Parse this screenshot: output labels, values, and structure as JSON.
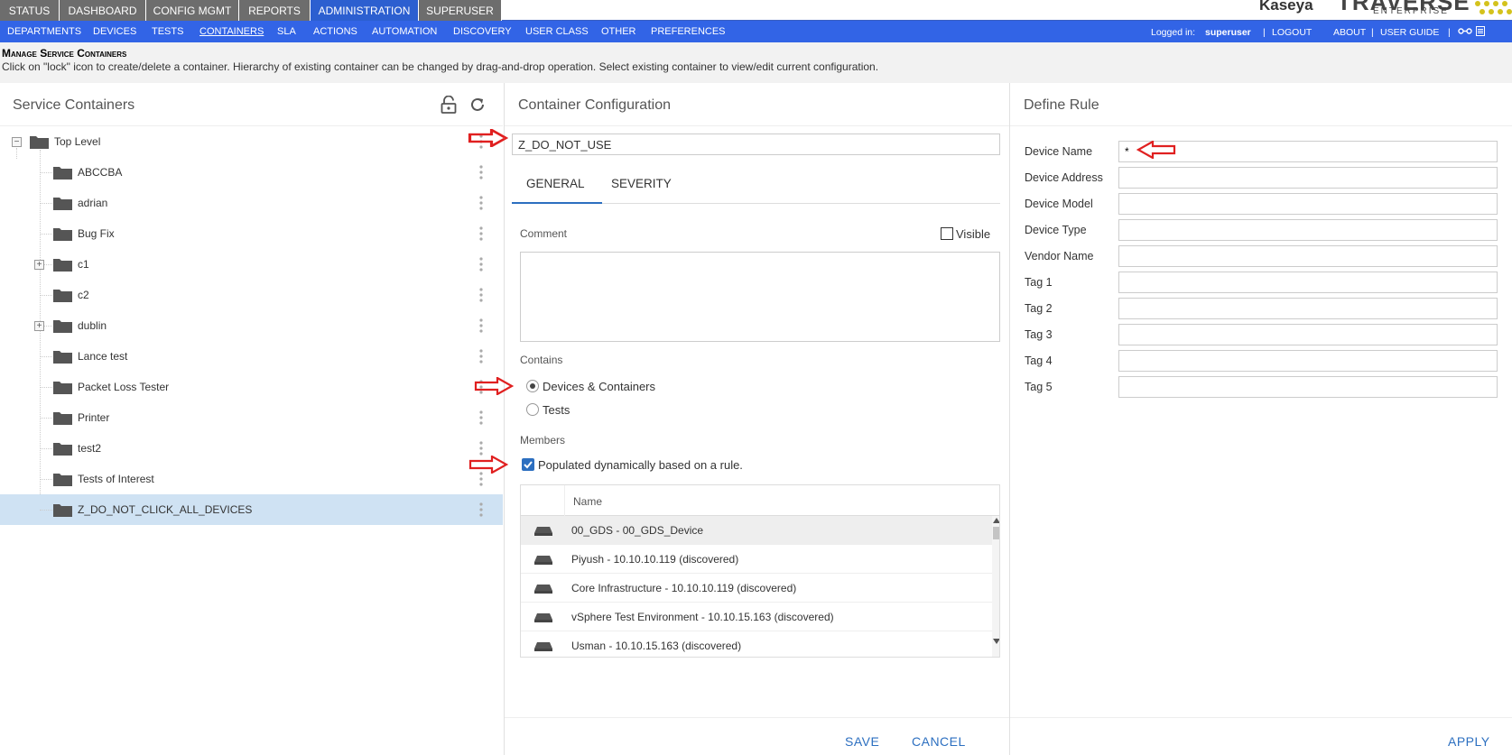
{
  "topnav": {
    "tabs": [
      {
        "label": "STATUS",
        "active": false
      },
      {
        "label": "DASHBOARD",
        "active": false
      },
      {
        "label": "CONFIG MGMT",
        "active": false
      },
      {
        "label": "REPORTS",
        "active": false
      },
      {
        "label": "ADMINISTRATION",
        "active": true
      },
      {
        "label": "SUPERUSER",
        "active": false
      }
    ],
    "brand": {
      "kaseya": "Kaseya",
      "product": "TRAVERSE",
      "edition": "ENTERPRISE"
    }
  },
  "subnav": {
    "items": [
      "DEPARTMENTS",
      "DEVICES",
      "TESTS",
      "CONTAINERS",
      "SLA",
      "ACTIONS",
      "AUTOMATION",
      "DISCOVERY",
      "USER CLASS",
      "OTHER",
      "PREFERENCES"
    ],
    "active": "CONTAINERS",
    "logged_in_label": "Logged in:",
    "username": "superuser",
    "logout": "LOGOUT",
    "about": "ABOUT",
    "user_guide": "USER GUIDE"
  },
  "page": {
    "title": "Manage Service Containers",
    "description": "Click on \"lock\" icon to create/delete a container. Hierarchy of existing container can be changed by drag-and-drop operation. Select existing container to view/edit current configuration."
  },
  "left": {
    "title": "Service Containers",
    "root": "Top Level",
    "items": [
      {
        "label": "ABCCBA",
        "expandable": false,
        "selected": false
      },
      {
        "label": "adrian",
        "expandable": false,
        "selected": false
      },
      {
        "label": "Bug Fix",
        "expandable": false,
        "selected": false
      },
      {
        "label": "c1",
        "expandable": true,
        "selected": false
      },
      {
        "label": "c2",
        "expandable": false,
        "selected": false
      },
      {
        "label": "dublin",
        "expandable": true,
        "selected": false
      },
      {
        "label": "Lance test",
        "expandable": false,
        "selected": false
      },
      {
        "label": "Packet Loss Tester",
        "expandable": false,
        "selected": false
      },
      {
        "label": "Printer",
        "expandable": false,
        "selected": false
      },
      {
        "label": "test2",
        "expandable": false,
        "selected": false
      },
      {
        "label": "Tests of Interest",
        "expandable": false,
        "selected": false
      },
      {
        "label": "Z_DO_NOT_CLICK_ALL_DEVICES",
        "expandable": false,
        "selected": true
      }
    ]
  },
  "mid": {
    "title": "Container Configuration",
    "container_name": "Z_DO_NOT_USE",
    "tabs": [
      "GENERAL",
      "SEVERITY"
    ],
    "active_tab": "GENERAL",
    "comment_label": "Comment",
    "visible_label": "Visible",
    "visible_checked": false,
    "comment_value": "",
    "contains_label": "Contains",
    "contains_options": [
      "Devices & Containers",
      "Tests"
    ],
    "contains_selected": "Devices & Containers",
    "members_label": "Members",
    "dynamic_label": "Populated dynamically based on a rule.",
    "dynamic_checked": true,
    "grid_header": "Name",
    "members": [
      "00_GDS - 00_GDS_Device",
      "Piyush - 10.10.10.119 (discovered)",
      "Core Infrastructure - 10.10.10.119 (discovered)",
      "vSphere Test Environment - 10.10.15.163 (discovered)",
      "Usman - 10.10.15.163 (discovered)"
    ],
    "save": "SAVE",
    "cancel": "CANCEL"
  },
  "right": {
    "title": "Define Rule",
    "fields": [
      {
        "label": "Device Name",
        "value": "*"
      },
      {
        "label": "Device Address",
        "value": ""
      },
      {
        "label": "Device Model",
        "value": ""
      },
      {
        "label": "Device Type",
        "value": ""
      },
      {
        "label": "Vendor Name",
        "value": ""
      },
      {
        "label": "Tag 1",
        "value": ""
      },
      {
        "label": "Tag 2",
        "value": ""
      },
      {
        "label": "Tag 3",
        "value": ""
      },
      {
        "label": "Tag 4",
        "value": ""
      },
      {
        "label": "Tag 5",
        "value": ""
      }
    ],
    "apply": "APPLY"
  },
  "colors": {
    "nav_active": "#2c5fd0",
    "subnav": "#3264e6",
    "selected_row": "#cfe2f3",
    "link": "#2c6fc0",
    "arrow": "#e02020"
  }
}
